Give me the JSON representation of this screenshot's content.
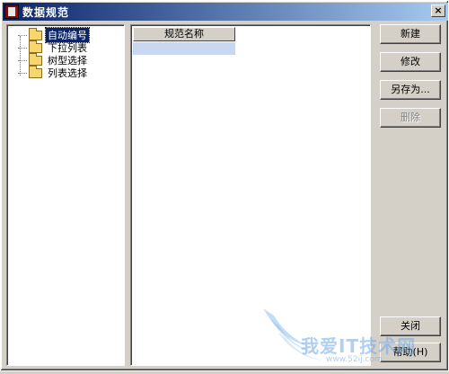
{
  "window": {
    "title": "数据规范",
    "close_label": "×"
  },
  "tree": {
    "items": [
      {
        "label": "自动编号",
        "selected": true
      },
      {
        "label": "下拉列表",
        "selected": false
      },
      {
        "label": "树型选择",
        "selected": false
      },
      {
        "label": "列表选择",
        "selected": false
      }
    ]
  },
  "list": {
    "columns": [
      "规范名称"
    ],
    "rows": []
  },
  "buttons": {
    "new": "新建",
    "edit": "修改",
    "save_as": "另存为...",
    "delete": "删除",
    "close": "关闭",
    "help": "帮助(H)"
  },
  "watermark": {
    "text": "我爱IT技术网",
    "sub": "www.52ij.com"
  }
}
